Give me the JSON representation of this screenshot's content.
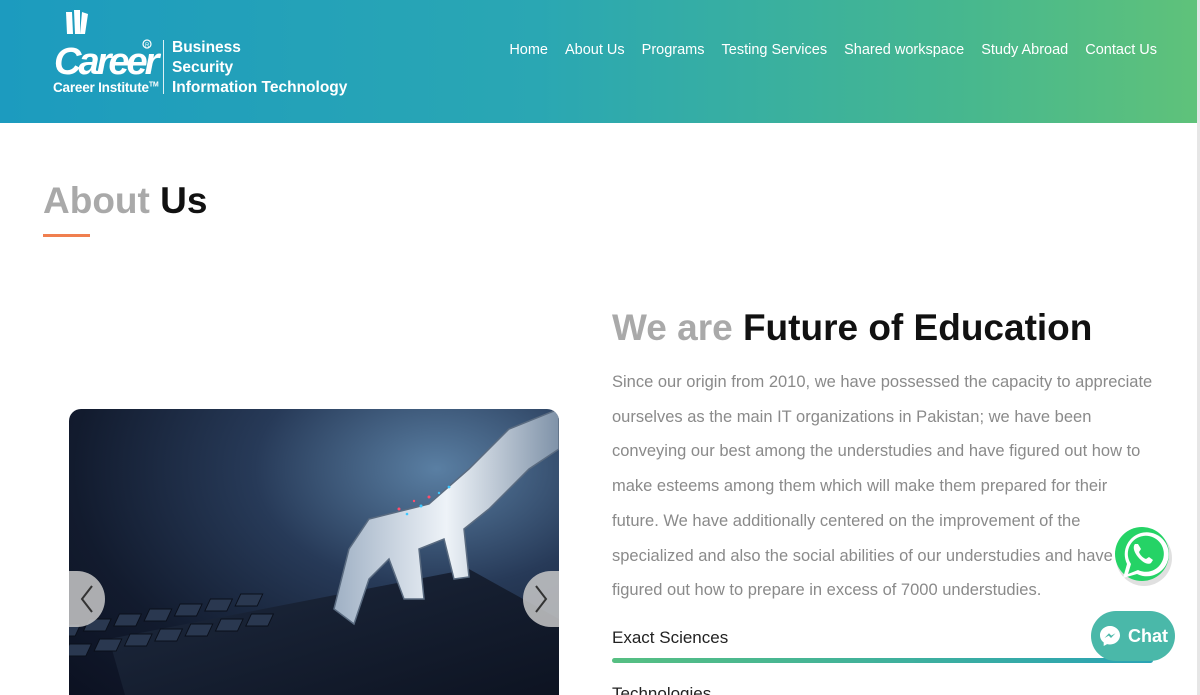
{
  "header": {
    "logo_text": "Career",
    "logo_subtitle": "Career Institute",
    "logo_tm": "TM",
    "tagline": [
      "Business",
      "Security",
      "Information Technology"
    ]
  },
  "nav": {
    "items": [
      "Home",
      "About Us",
      "Programs",
      "Testing Services",
      "Shared workspace",
      "Study Abroad",
      "Contact Us"
    ]
  },
  "about": {
    "title_light": "About",
    "title_dark": "Us"
  },
  "content": {
    "heading_light": "We are",
    "heading_dark": "Future of Education",
    "paragraph": "Since our origin from 2010, we have possessed the capacity to appreciate ourselves as the main IT organizations in Pakistan; we have been conveying our best among the understudies and have figured out how to make esteems among them which will make them prepared for their future. We have additionally centered on the improvement of the specialized and also the social abilities of our understudies and have figured out how to prepare in excess of 7000 understudies.",
    "skills": [
      {
        "label": "Exact Sciences",
        "level": 1.0
      },
      {
        "label": "Technologies"
      }
    ]
  },
  "widgets": {
    "chat_label": "Chat"
  },
  "colors": {
    "header_start": "#1c9bbf",
    "header_end": "#5fc27a",
    "accent_underline": "#f07f4f",
    "whatsapp_green": "#25d366",
    "chat_teal": "#4ab8a9"
  },
  "icons": [
    "career-logo-icon",
    "chevron-left-icon",
    "chevron-right-icon",
    "whatsapp-icon",
    "messenger-icon"
  ]
}
